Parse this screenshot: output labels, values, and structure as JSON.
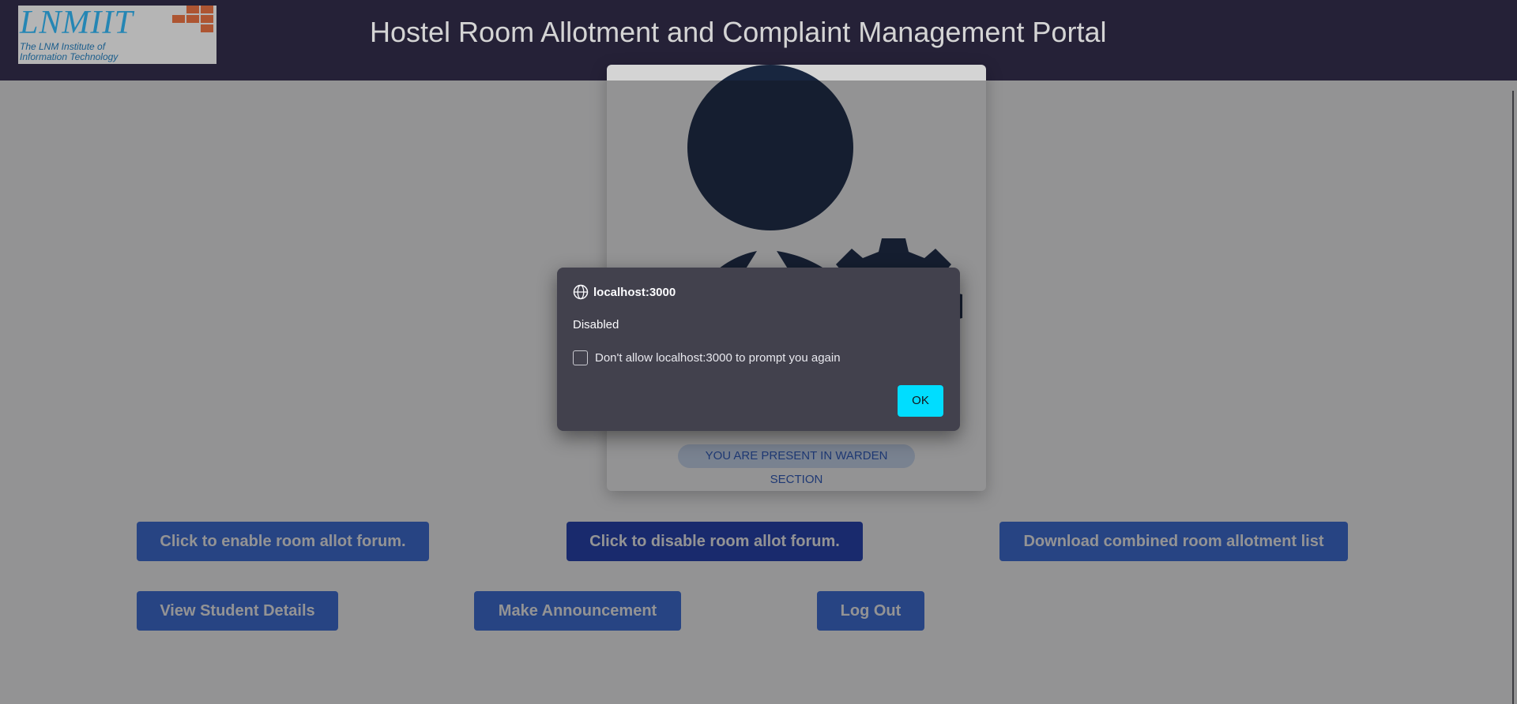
{
  "header": {
    "logo": {
      "main": "LNMIIT",
      "line1": "The LNM Institute of",
      "line2": "Information Technology"
    },
    "title": "Hostel Room Allotment and Complaint Management Portal"
  },
  "card": {
    "avatar_icon": "warden-admin-avatar-icon",
    "badge": "YOU ARE PRESENT IN WARDEN SECTION"
  },
  "actions": {
    "enable_forum": "Click to enable room allot forum.",
    "disable_forum": "Click to disable room allot forum.",
    "download_list": "Download combined room allotment list",
    "view_students": "View Student Details",
    "make_announcement": "Make Announcement",
    "logout": "Log Out"
  },
  "dialog": {
    "origin": "localhost:3000",
    "message": "Disabled",
    "checkbox_label": "Don't allow localhost:3000 to prompt you again",
    "checkbox_checked": false,
    "ok_label": "OK"
  },
  "colors": {
    "header_bg": "#2a2540",
    "button_bg": "#3b6fe0",
    "button_active_bg": "#2240b8",
    "dialog_bg": "#42414d",
    "ok_bg": "#00ddff"
  }
}
